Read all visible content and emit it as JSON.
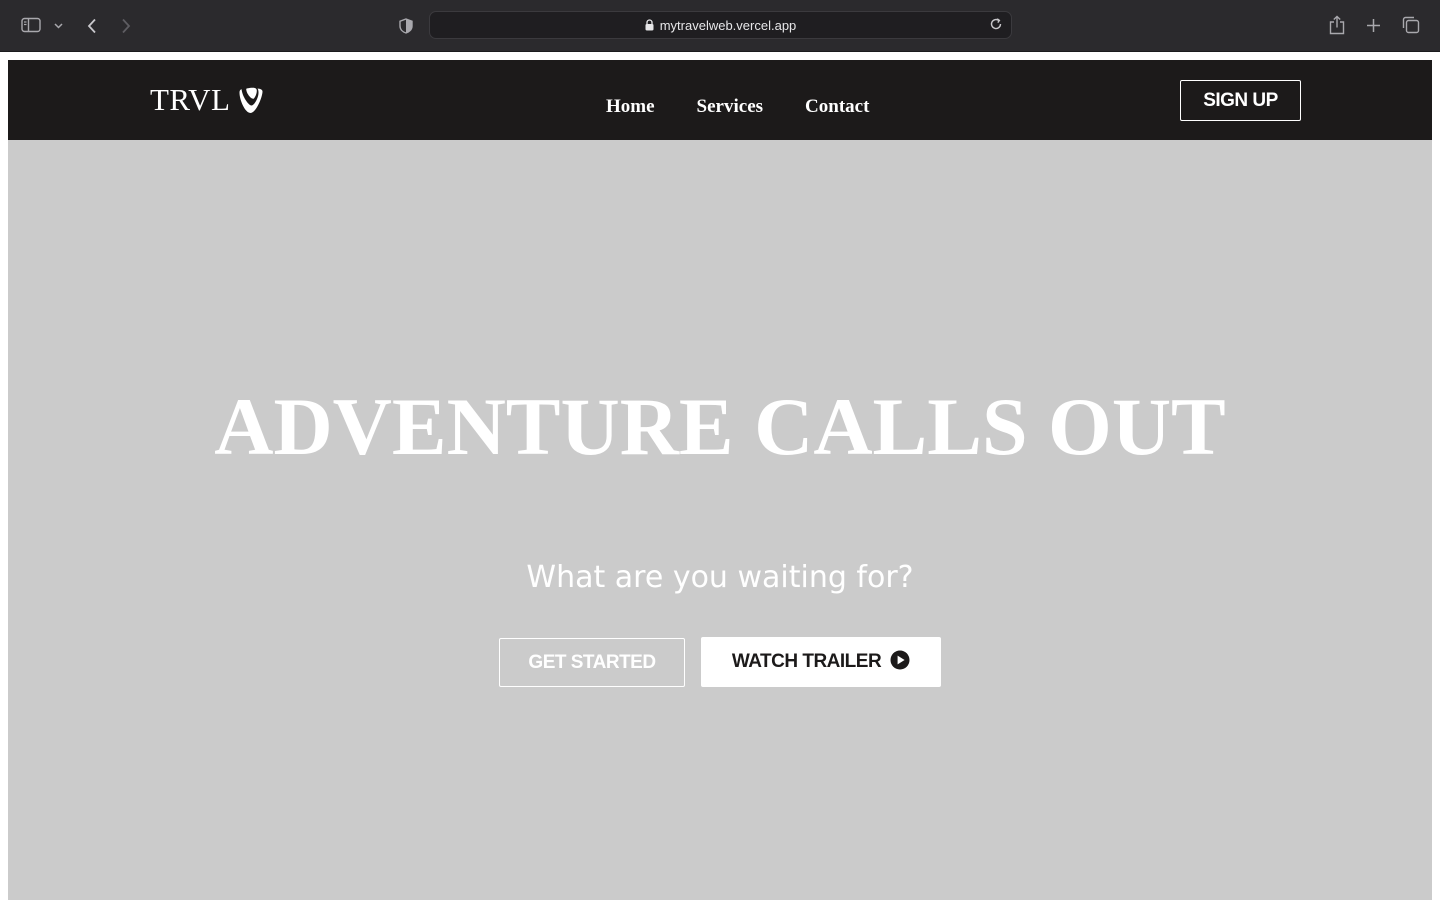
{
  "browser": {
    "url": "mytravelweb.vercel.app",
    "icons": {
      "sidebar": "sidebar-icon",
      "sidebar_menu": "chevron-down-icon",
      "back": "chevron-left-icon",
      "forward": "chevron-right-icon",
      "privacy": "shield-icon",
      "lock": "lock-icon",
      "reload": "reload-icon",
      "share": "share-icon",
      "new_tab": "plus-icon",
      "tabs": "tabs-overview-icon"
    }
  },
  "nav": {
    "logo_text": "TRVL",
    "logo_icon": "typo3-logo-icon",
    "links": [
      "Home",
      "Services",
      "Contact"
    ],
    "signup_label": "SIGN UP"
  },
  "hero": {
    "title": "ADVENTURE CALLS OUT",
    "subtitle": "What are you waiting for?",
    "primary_button": "GET STARTED",
    "secondary_button": "WATCH TRAILER",
    "secondary_icon": "play-circle-icon"
  },
  "colors": {
    "browser_chrome": "#2b2a2d",
    "nav_background": "#1c1a1a",
    "hero_background": "#cbcbcb",
    "text_light": "#ffffff",
    "text_dark": "#1c1a1a"
  }
}
